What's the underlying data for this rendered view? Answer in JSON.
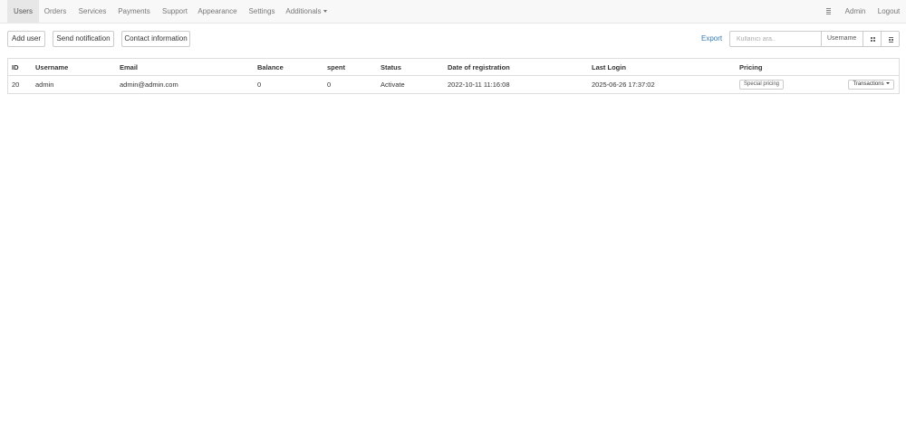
{
  "nav": {
    "items": [
      {
        "label": "Users",
        "active": true
      },
      {
        "label": "Orders"
      },
      {
        "label": "Services"
      },
      {
        "label": "Payments"
      },
      {
        "label": "Support"
      },
      {
        "label": "Appearance"
      },
      {
        "label": "Settings"
      },
      {
        "label": "Additionals"
      }
    ],
    "admin_icon": "document-icon",
    "admin_label": "Admin",
    "logout_label": "Logout"
  },
  "toolbar": {
    "add_user": "Add user",
    "send_notification": "Send notification",
    "contact_information": "Contact information",
    "export": "Export",
    "search_placeholder": "Kullanıcı ara..",
    "search_value": "",
    "filter_selected": "Username",
    "view_icons": [
      "grid-icon",
      "grid-alt-icon"
    ]
  },
  "table": {
    "columns": [
      "ID",
      "Username",
      "Email",
      "Balance",
      "spent",
      "Status",
      "Date of registration",
      "Last Login",
      "Pricing"
    ],
    "rows": [
      {
        "id": "20",
        "username": "admin",
        "email": "admin@admin.com",
        "balance": "0",
        "spent": "0",
        "status": "Activate",
        "registered": "2022-10-11 11:16:08",
        "last_login": "2025-06-26 17:37:02",
        "pricing": "Special pricing",
        "action": "Transactions"
      }
    ]
  },
  "colors": {
    "navbar_bg": "#f8f8f8",
    "nav_active_bg": "#e7e7e7",
    "link": "#337ab7",
    "border": "#dddddd"
  }
}
